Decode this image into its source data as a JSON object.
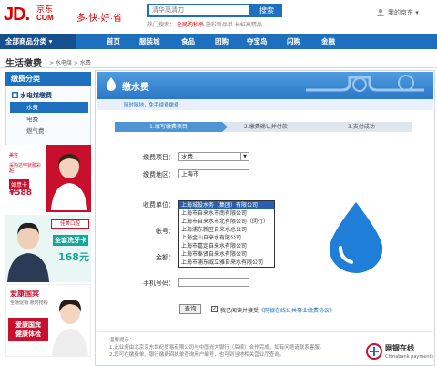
{
  "header": {
    "logo_jd": "JD.",
    "logo_com": "京东\nCOM",
    "slogan": "多·快·好·省",
    "search_placeholder": "清华高清刀",
    "search_button": "搜索",
    "hot_label": "热门搜索：",
    "hot_items": [
      "全民购秒杀",
      "施彩新品单",
      "长虹高精品"
    ],
    "user_text": "我的京东 ▾"
  },
  "nav": {
    "all_categories": "全部商品分类 ▾",
    "items": [
      "首页",
      "服装城",
      "食品",
      "团购",
      "夺宝岛",
      "闪购",
      "金融"
    ]
  },
  "breadcrumb": {
    "title": "生活缴费",
    "path": "> 水电煤 > 水费"
  },
  "sidebar": {
    "heading": "缴费分类",
    "category": "水电煤缴费",
    "items": [
      "水费",
      "电费",
      "燃气费"
    ],
    "active_index": 0,
    "ads": [
      {
        "line1": "美容",
        "line2": "如意卡",
        "price": "¥588",
        "text": "采购达甲状腺彩超"
      },
      {
        "line1": "佳美口腔",
        "line2": "全套洗牙卡",
        "price": "168元"
      },
      {
        "line1": "爱康国宾",
        "line2": "全场促销 限时抢购",
        "line3": "爱康国宾\n健康体检"
      }
    ]
  },
  "main": {
    "title": "缴水费",
    "subtitle": "随时随地，免手续费缴费",
    "steps": [
      "1.填写缴费项目",
      "2.缴费确认并付款",
      "3.支付成功"
    ],
    "form": {
      "item_label": "缴费项目：",
      "item_value": "水费",
      "region_label": "缴费地区：",
      "region_value": "上海市",
      "unit_label": "收费单位：",
      "account_label": "帐号：",
      "amount_label": "金额：",
      "phone_label": "手机号码："
    },
    "dropdown_options": [
      "上海城投水务（集团）有限公司",
      "上海市自来水市南有限公司",
      "上海市自来水市北有限公司（闵行）",
      "上海浦东新区自来水总公司",
      "上海金山自来水有限公司",
      "上海市嘉定自来水有限公司",
      "上海市奉贤自来水有限公司",
      "上海市浦东威立雅自来水有限公司"
    ],
    "selected_option_index": 0,
    "query_button": "查询",
    "agree_text": "我已阅读并接受",
    "agree_link": "《网银在线公共事业缴费协议》",
    "notes_title": "温馨提示：",
    "notes": [
      "1.此业务由北京京东世纪贸易有限公司与中国光大银行（后续）合作完成，如有问题请联系客服。",
      "2.您可在缴费单、银行缴费回执单查询用户编号，也可到当地相关营业厅查询。"
    ],
    "chinapay_name": "网银在线",
    "chinapay_en": "Chinabank payments"
  },
  "colors": {
    "brand_red": "#dd0000",
    "nav_blue": "#1f6fbf",
    "nav_dark": "#174f8e",
    "water_blue": "#1f7fd8"
  }
}
